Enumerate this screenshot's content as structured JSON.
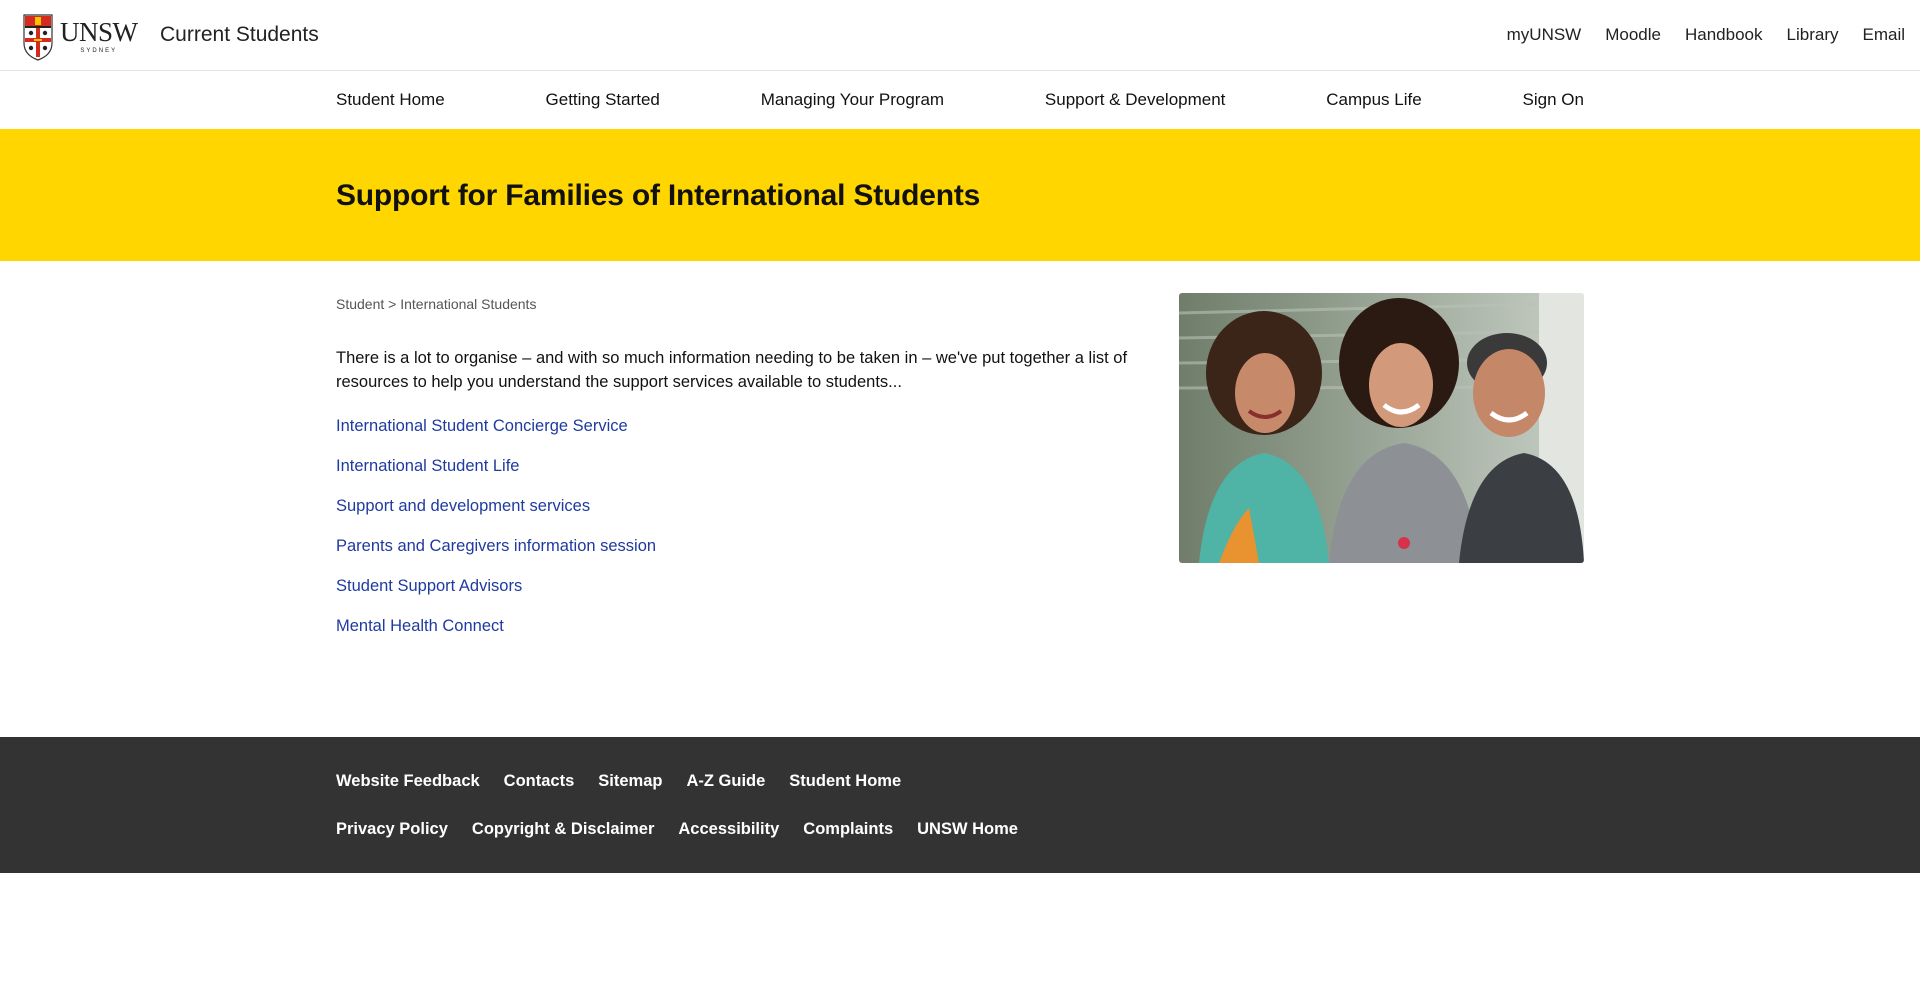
{
  "header": {
    "logo_word": "UNSW",
    "logo_sub": "SYDNEY",
    "site_title": "Current Students",
    "utility_links": [
      "myUNSW",
      "Moodle",
      "Handbook",
      "Library",
      "Email"
    ]
  },
  "nav": {
    "items": [
      "Student Home",
      "Getting Started",
      "Managing Your Program",
      "Support & Development",
      "Campus Life",
      "Sign On"
    ]
  },
  "hero": {
    "title": "Support for Families of International Students",
    "background_color": "#ffd600"
  },
  "breadcrumb": {
    "items": [
      "Student",
      "International Students"
    ],
    "separator": ">"
  },
  "main": {
    "intro": "There is a lot to organise – and with so much information needing to be taken in – we've put together a list of resources to help you understand the support services available to students...",
    "links": [
      "International Student Concierge Service",
      "International Student Life",
      "Support and development services",
      "Parents and Caregivers information session",
      "Student Support Advisors",
      "Mental Health Connect"
    ],
    "link_color": "#1f3aa0"
  },
  "footer": {
    "row1": [
      "Website Feedback",
      "Contacts",
      "Sitemap",
      "A-Z Guide",
      "Student Home"
    ],
    "row2": [
      "Privacy Policy",
      "Copyright & Disclaimer",
      "Accessibility",
      "Complaints",
      "UNSW Home"
    ],
    "background_color": "#333333"
  }
}
